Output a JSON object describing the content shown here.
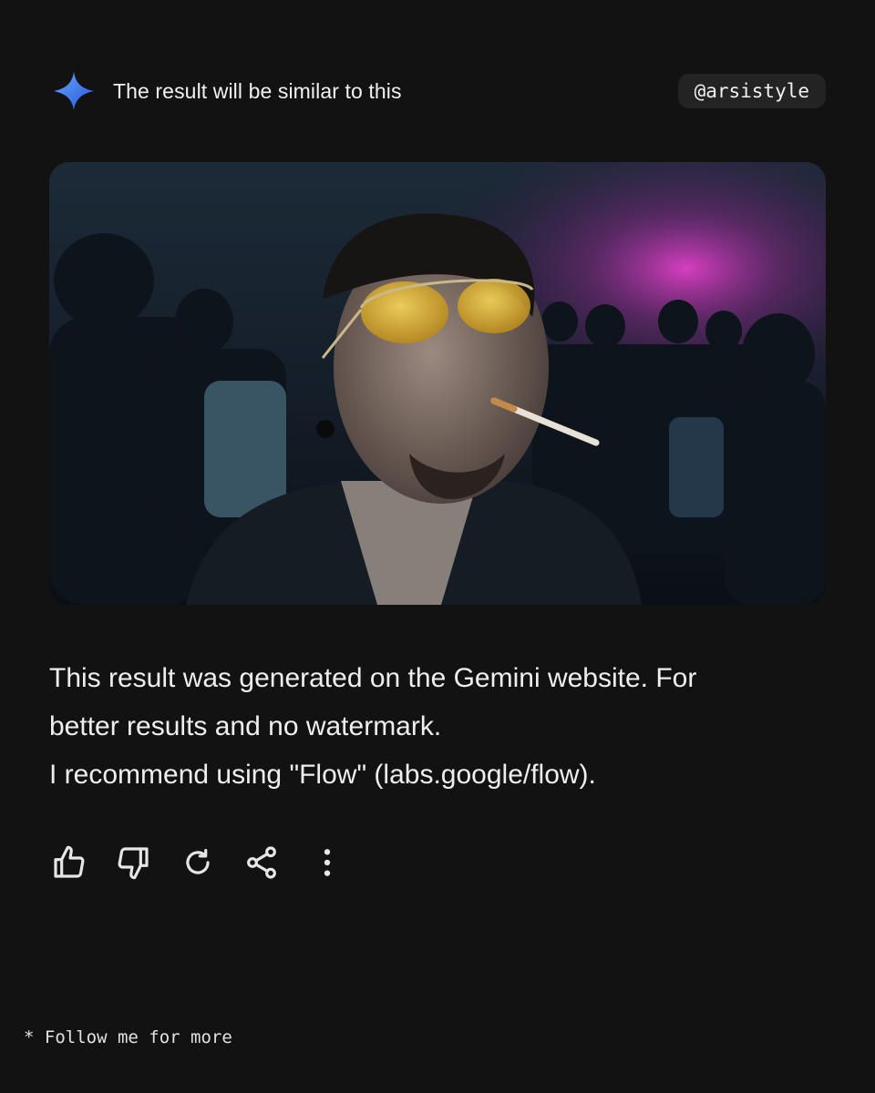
{
  "header": {
    "title": "The result will be similar to this",
    "handle": "@arsistyle",
    "icon": "gemini-sparkle-icon"
  },
  "image": {
    "description_icon": "generated-photo"
  },
  "message": {
    "lines": [
      "This result was generated on the Gemini website. For",
      "better results and no watermark.",
      "I recommend using \"Flow\" (labs.google/flow)."
    ]
  },
  "actions": {
    "icons": [
      "thumbs-up-icon",
      "thumbs-down-icon",
      "regenerate-icon",
      "share-icon",
      "more-vert-icon"
    ]
  },
  "footer": {
    "text": "* Follow me for more"
  },
  "colors": {
    "background": "#121212",
    "sparkle_start": "#4f8ff7",
    "sparkle_end": "#2a5fe0",
    "handle_bg": "#232323"
  }
}
